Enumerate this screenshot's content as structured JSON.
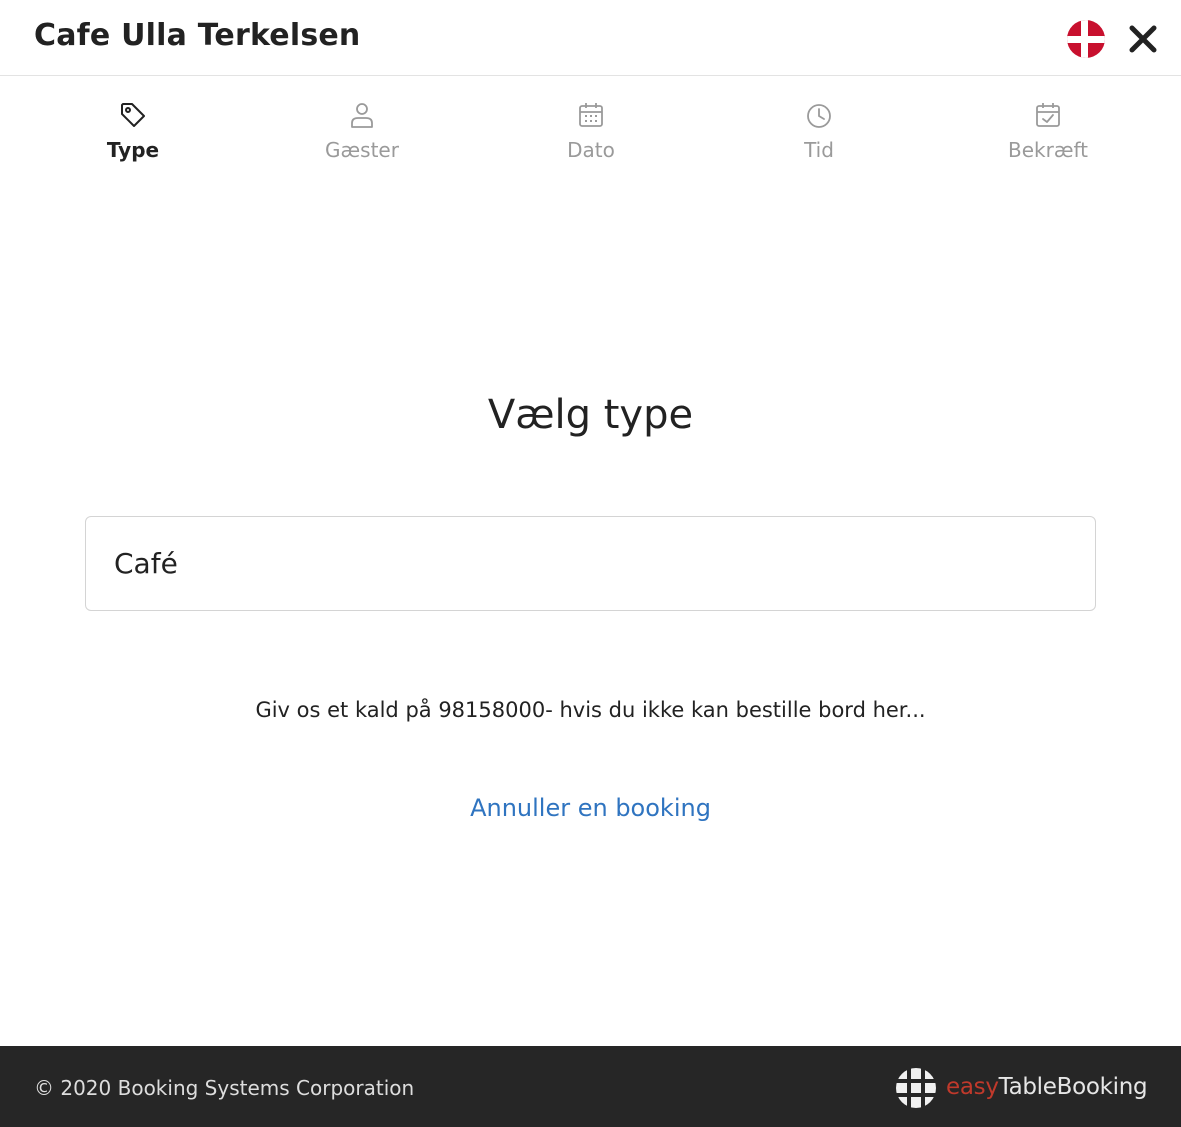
{
  "header": {
    "title": "Cafe Ulla Terkelsen",
    "language_flag": "danish-flag-icon",
    "close_icon": "close-icon"
  },
  "steps": [
    {
      "label": "Type",
      "icon": "tag-icon",
      "active": true
    },
    {
      "label": "Gæster",
      "icon": "user-icon",
      "active": false
    },
    {
      "label": "Dato",
      "icon": "calendar-icon",
      "active": false
    },
    {
      "label": "Tid",
      "icon": "clock-icon",
      "active": false
    },
    {
      "label": "Bekræft",
      "icon": "calendar-check-icon",
      "active": false
    }
  ],
  "main": {
    "heading": "Vælg type",
    "type_options": [
      "Café"
    ],
    "info_text": "Giv os et kald på 98158000- hvis du ikke kan bestille bord her...",
    "cancel_link": "Annuller en booking"
  },
  "footer": {
    "copyright": "© 2020 Booking Systems Corporation",
    "brand_easy": "easy",
    "brand_rest": "TableBooking",
    "brand_logo": "globe-grid-icon"
  },
  "colors": {
    "link": "#2f74c0",
    "footer_bg": "#262626",
    "flag_red": "#c8102e",
    "brand_red": "#c0392b",
    "inactive_step": "#9a9a9a"
  }
}
